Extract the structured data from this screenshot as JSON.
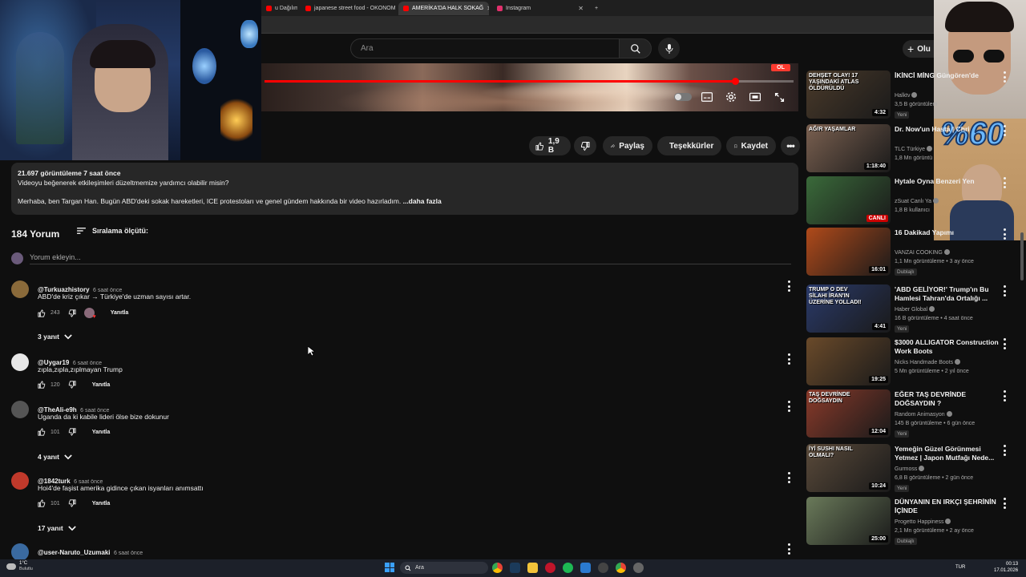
{
  "browser": {
    "tabs": [
      {
        "label": "u Dağılım?",
        "active": false,
        "color": "#ff0000"
      },
      {
        "label": "japanese street food - OKONOMI",
        "active": false,
        "color": "#ff0000"
      },
      {
        "label": "AMERİKA'DA HALK SOKAĞ",
        "active": true,
        "color": "#ff0000"
      },
      {
        "label": "Instagram",
        "active": false,
        "color": "#e1306c"
      }
    ],
    "new_tab": "+"
  },
  "header": {
    "search_placeholder": "Ara",
    "create_label": "Olu"
  },
  "video": {
    "progress_fraction": 0.89,
    "badge": "OL"
  },
  "actions": {
    "likes": "1,9 B",
    "share": "Paylaş",
    "thanks": "Teşekkürler",
    "save": "Kaydet"
  },
  "description": {
    "stats": "21.697 görüntüleme  7 saat önce",
    "line1": "Videoyu beğenerek etkileşimleri düzeltmemize yardımcı olabilir misin?",
    "line2": "Merhaba, ben Targan Han. Bugün ABD'deki sokak hareketleri, ICE protestoları ve genel gündem hakkında bir video hazırladım.",
    "more": "...daha fazla"
  },
  "comments_header": {
    "count": "184 Yorum",
    "sort": "Sıralama ölçütü:",
    "add_placeholder": "Yorum ekleyin..."
  },
  "comments": [
    {
      "author": "@Turkuazhistory",
      "time": "6 saat önce",
      "text": "ABD'de kriz çıkar → Türkiye'de uzman sayısı artar.",
      "likes": "243",
      "reply": "Yanıtla",
      "replies": "3 yanıt",
      "avatar_color": "#8a6a3a"
    },
    {
      "author": "@Uygar19",
      "time": "6 saat önce",
      "text": "zıpla,zıpla,zıplmayan Trump",
      "likes": "120",
      "reply": "Yanıtla",
      "replies": "",
      "avatar_color": "#e8e8e8"
    },
    {
      "author": "@TheAli-e9h",
      "time": "6 saat önce",
      "text": "Uganda da ki kabile lideri ölse bize dokunur",
      "likes": "101",
      "reply": "Yanıtla",
      "replies": "4 yanıt",
      "avatar_color": "#555555"
    },
    {
      "author": "@1842turk",
      "time": "6 saat önce",
      "text": "Hoi4'de faşist amerika gidince çıkan isyanları anımsattı",
      "likes": "101",
      "reply": "Yanıtla",
      "replies": "17 yanıt",
      "avatar_color": "#c0392b"
    },
    {
      "author": "@user-Naruto_Uzumaki",
      "time": "6 saat önce",
      "text": "",
      "likes": "",
      "reply": "",
      "replies": "",
      "avatar_color": "#3a6aa0"
    }
  ],
  "sidebar": [
    {
      "title": "İKİNCİ MİNG Güngören'de",
      "channel": "Halktv",
      "meta": "3,5 B görüntülem",
      "badge": "Yeni",
      "duration": "4:32",
      "thumb_text": "DEHŞET OLAY! 17 YAŞINDAKİ ATLAS ÖLDÜRÜLDÜ",
      "thumb_color": "#4a3a2a"
    },
    {
      "title": "Dr. Now'un Hasta | Chri",
      "channel": "TLC Türkiye",
      "meta": "1,8 Mn görüntü",
      "badge": "",
      "duration": "1:18:40",
      "thumb_text": "AĞIR YAŞAMLAR",
      "thumb_color": "#7a6050"
    },
    {
      "title": "Hytale Oyna Benzeri Yen",
      "channel": "zSuat Canlı Ya",
      "meta": "1,8 B kullanıcı",
      "badge": "",
      "duration": "CANLI",
      "thumb_text": "",
      "thumb_color": "#3a6a3a"
    },
    {
      "title": "16 Dakikad Yapımı",
      "channel": "VANZAI COOKING",
      "meta": "1,1 Mn görüntüleme • 3 ay önce",
      "badge": "Dublajlı",
      "duration": "16:01",
      "thumb_text": "",
      "thumb_color": "#b04a1a"
    },
    {
      "title": "'ABD GELİYOR!' Trump'ın Bu Hamlesi Tahran'da Ortalığı ...",
      "channel": "Haber Global",
      "meta": "16 B görüntüleme • 4 saat önce",
      "badge": "Yeni",
      "duration": "4:41",
      "thumb_text": "TRUMP O DEV SİLAHI İRAN'IN ÜZERİNE YOLLADI!",
      "thumb_color": "#2a3a6a"
    },
    {
      "title": "$3000 ALLIGATOR Construction Work Boots",
      "channel": "Nicks Handmade Boots",
      "meta": "5 Mn görüntüleme • 2 yıl önce",
      "badge": "",
      "duration": "19:25",
      "thumb_text": "",
      "thumb_color": "#6a4a2a"
    },
    {
      "title": "EĞER TAŞ DEVRİNDE DOĞSAYDIN ?",
      "channel": "Random Animasyon",
      "meta": "145 B görüntüleme • 6 gün önce",
      "badge": "Yeni",
      "duration": "12:04",
      "thumb_text": "TAŞ DEVRİNDE DOĞSAYDIN",
      "thumb_color": "#8a3a2a"
    },
    {
      "title": "Yemeğin Güzel Görünmesi Yetmez | Japon Mutfağı Nede...",
      "channel": "Gurmoss",
      "meta": "6,8 B görüntüleme • 2 gün önce",
      "badge": "Yeni",
      "duration": "10:24",
      "thumb_text": "İYİ SUSHI NASIL OLMALI?",
      "thumb_color": "#5a4a3a"
    },
    {
      "title": "DÜNYANIN EN IRKÇI ŞEHRİNİN İÇİNDE",
      "channel": "Progetto Happiness",
      "meta": "2,1 Mn görüntüleme • 2 ay önce",
      "badge": "Dublajlı",
      "duration": "25:00",
      "thumb_text": "",
      "thumb_color": "#6a7a5a"
    }
  ],
  "cam_right_text": "%60",
  "taskbar": {
    "weather_temp": "1°C",
    "weather_desc": "Bulutlu",
    "search": "Ara",
    "lang": "TUR",
    "time": "00:13",
    "date": "17.01.2026"
  }
}
